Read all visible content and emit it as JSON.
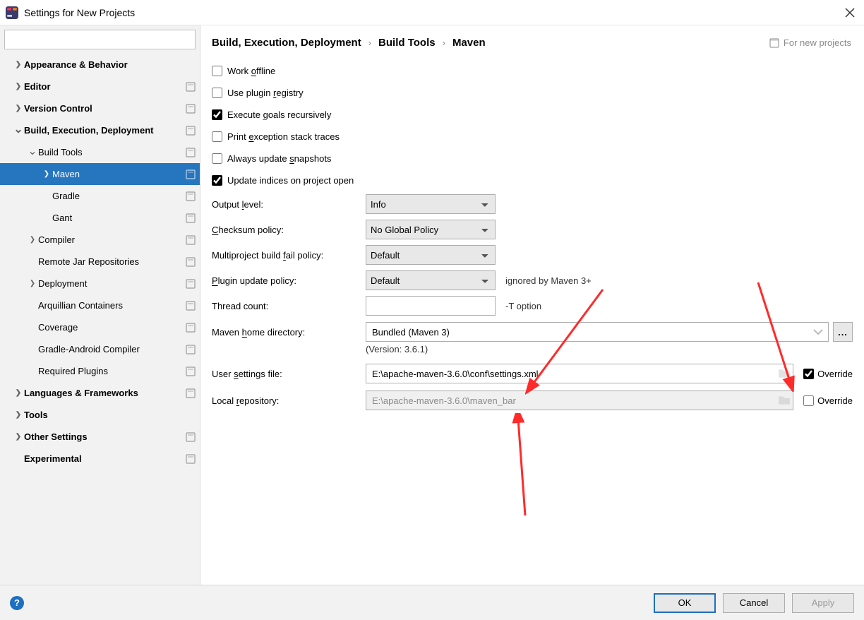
{
  "window": {
    "title": "Settings for New Projects"
  },
  "search": {
    "placeholder": ""
  },
  "sidebar": {
    "items": [
      {
        "label": "Appearance & Behavior",
        "level": 0,
        "arrow": "right",
        "bold": true,
        "proj": false
      },
      {
        "label": "Editor",
        "level": 0,
        "arrow": "right",
        "bold": true,
        "proj": true
      },
      {
        "label": "Version Control",
        "level": 0,
        "arrow": "right",
        "bold": true,
        "proj": true
      },
      {
        "label": "Build, Execution, Deployment",
        "level": 0,
        "arrow": "down",
        "bold": true,
        "proj": true
      },
      {
        "label": "Build Tools",
        "level": 1,
        "arrow": "down",
        "bold": false,
        "proj": true
      },
      {
        "label": "Maven",
        "level": 2,
        "arrow": "right",
        "bold": false,
        "proj": true,
        "selected": true
      },
      {
        "label": "Gradle",
        "level": 2,
        "arrow": "",
        "bold": false,
        "proj": true
      },
      {
        "label": "Gant",
        "level": 2,
        "arrow": "",
        "bold": false,
        "proj": true
      },
      {
        "label": "Compiler",
        "level": 1,
        "arrow": "right",
        "bold": false,
        "proj": true
      },
      {
        "label": "Remote Jar Repositories",
        "level": 1,
        "arrow": "",
        "bold": false,
        "proj": true
      },
      {
        "label": "Deployment",
        "level": 1,
        "arrow": "right",
        "bold": false,
        "proj": true
      },
      {
        "label": "Arquillian Containers",
        "level": 1,
        "arrow": "",
        "bold": false,
        "proj": true
      },
      {
        "label": "Coverage",
        "level": 1,
        "arrow": "",
        "bold": false,
        "proj": true
      },
      {
        "label": "Gradle-Android Compiler",
        "level": 1,
        "arrow": "",
        "bold": false,
        "proj": true
      },
      {
        "label": "Required Plugins",
        "level": 1,
        "arrow": "",
        "bold": false,
        "proj": true
      },
      {
        "label": "Languages & Frameworks",
        "level": 0,
        "arrow": "right",
        "bold": true,
        "proj": true
      },
      {
        "label": "Tools",
        "level": 0,
        "arrow": "right",
        "bold": true,
        "proj": false
      },
      {
        "label": "Other Settings",
        "level": 0,
        "arrow": "right",
        "bold": true,
        "proj": true
      },
      {
        "label": "Experimental",
        "level": 0,
        "arrow": "",
        "bold": true,
        "proj": true
      }
    ]
  },
  "breadcrumb": {
    "part1": "Build, Execution, Deployment",
    "part2": "Build Tools",
    "part3": "Maven",
    "scope": "For new projects"
  },
  "checks": {
    "work_offline": "Work offline",
    "plugin_registry": "Use plugin registry",
    "execute_goals": "Execute goals recursively",
    "print_exception": "Print exception stack traces",
    "always_snapshots": "Always update snapshots",
    "update_indices": "Update indices on project open"
  },
  "fields": {
    "output_level": {
      "label": "Output level:",
      "value": "Info"
    },
    "checksum_policy": {
      "label": "Checksum policy:",
      "value": "No Global Policy"
    },
    "multiproject_fail": {
      "label": "Multiproject build fail policy:",
      "value": "Default"
    },
    "plugin_update": {
      "label": "Plugin update policy:",
      "value": "Default",
      "hint": "ignored by Maven 3+"
    },
    "thread_count": {
      "label": "Thread count:",
      "value": "",
      "hint": "-T option"
    },
    "maven_home": {
      "label": "Maven home directory:",
      "value": "Bundled (Maven 3)"
    },
    "maven_version": "(Version: 3.6.1)",
    "user_settings": {
      "label": "User settings file:",
      "value": "E:\\apache-maven-3.6.0\\conf\\settings.xml",
      "override_label": "Override",
      "override_checked": true
    },
    "local_repo": {
      "label": "Local repository:",
      "value": "E:\\apache-maven-3.6.0\\maven_bar",
      "override_label": "Override",
      "override_checked": false
    }
  },
  "footer": {
    "ok": "OK",
    "cancel": "Cancel",
    "apply": "Apply"
  }
}
